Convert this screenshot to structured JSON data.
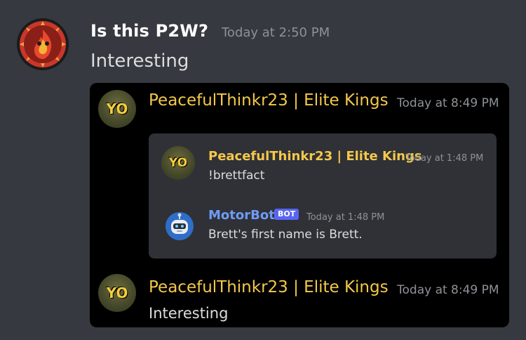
{
  "message": {
    "username": "Is this P2W?",
    "timestamp": "Today at 2:50 PM",
    "text": "Interesting"
  },
  "embed": {
    "header": {
      "username": "PeacefulThinkr23 | Elite Kings",
      "timestamp": "Today at 8:49 PM",
      "avatar_text": "YO"
    },
    "quoted": {
      "first": {
        "username": "PeacefulThinkr23 | Elite Kings",
        "timestamp": "Today at 1:48 PM",
        "text": "!brettfact",
        "avatar_text": "YO"
      },
      "second": {
        "username": "MotorBot",
        "badge": "BOT",
        "timestamp": "Today at 1:48 PM",
        "text": "Brett's first name is Brett."
      }
    },
    "footer": {
      "username": "PeacefulThinkr23 | Elite Kings",
      "timestamp": "Today at 8:49 PM",
      "text": "Interesting",
      "avatar_text": "YO"
    }
  },
  "colors": {
    "background": "#36393f",
    "username_gold": "#f4c84b",
    "motorbot_blue": "#6f9bf5",
    "bot_badge": "#5865f2"
  }
}
